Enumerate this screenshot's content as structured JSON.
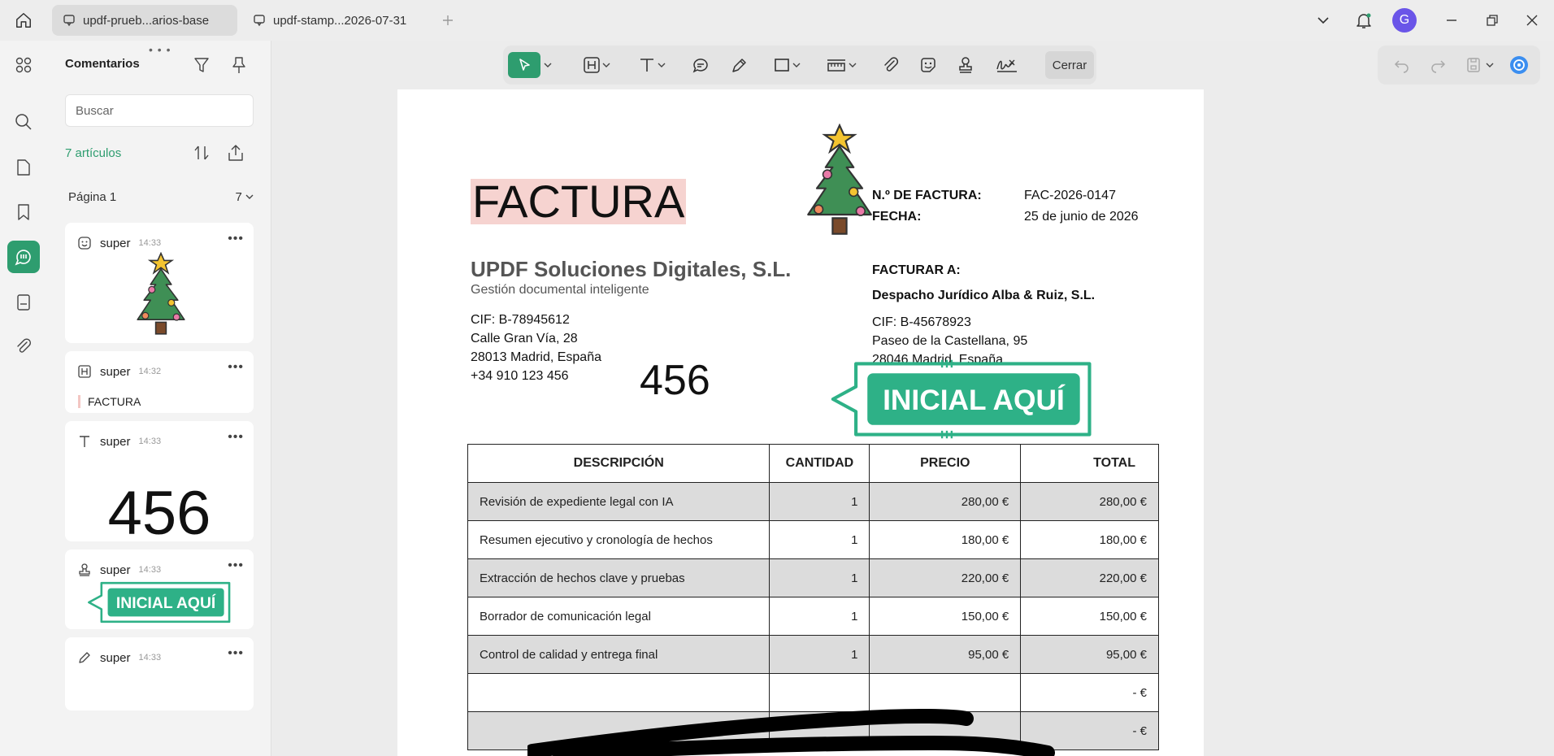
{
  "tabs": [
    {
      "label": "updf-prueb...arios-base",
      "active": true
    },
    {
      "label": "updf-stamp...2026-07-31",
      "active": false
    }
  ],
  "avatar_letter": "G",
  "panel": {
    "title": "Comentarios",
    "search_placeholder": "Buscar",
    "count": "7 artículos",
    "page_label": "Página 1",
    "page_count": "7"
  },
  "comments": [
    {
      "type": "sticker",
      "user": "super",
      "time": "14:33"
    },
    {
      "type": "highlight",
      "user": "super",
      "time": "14:32",
      "text": "FACTURA"
    },
    {
      "type": "text",
      "user": "super",
      "time": "14:33",
      "text": "456"
    },
    {
      "type": "stamp",
      "user": "super",
      "time": "14:33",
      "stamp_text": "INICIAL AQUÍ"
    },
    {
      "type": "pencil",
      "user": "super",
      "time": "14:33"
    }
  ],
  "toolbar": {
    "close_label": "Cerrar"
  },
  "invoice": {
    "title": "FACTURA",
    "company": "UPDF Soluciones Digitales, S.L.",
    "tagline": "Gestión documental inteligente",
    "sender": [
      "CIF: B-78945612",
      "Calle Gran Vía, 28",
      "28013 Madrid, España",
      "+34 910 123 456"
    ],
    "number_label": "N.º DE FACTURA:",
    "number": "FAC-2026-0147",
    "date_label": "FECHA:",
    "date": "25 de junio de 2026",
    "bill_to_label": "FACTURAR A:",
    "client": "Despacho Jurídico Alba & Ruiz, S.L.",
    "client_lines": [
      "CIF: B-45678923",
      "Paseo de la Castellana, 95",
      "28046 Madrid, España"
    ],
    "annotation_text": "456",
    "stamp_text": "INICIAL AQUÍ",
    "table": {
      "headers": [
        "DESCRIPCIÓN",
        "CANTIDAD",
        "PRECIO",
        "TOTAL"
      ],
      "rows": [
        [
          "Revisión de expediente legal con IA",
          "1",
          "280,00 €",
          "280,00 €"
        ],
        [
          "Resumen ejecutivo y cronología de hechos",
          "1",
          "180,00 €",
          "180,00 €"
        ],
        [
          "Extracción de hechos clave y pruebas",
          "1",
          "220,00 €",
          "220,00 €"
        ],
        [
          "Borrador de comunicación legal",
          "1",
          "150,00 €",
          "150,00 €"
        ],
        [
          "Control de calidad y entrega final",
          "1",
          "95,00 €",
          "95,00 €"
        ],
        [
          "",
          "",
          "",
          "- €"
        ],
        [
          "",
          "",
          "",
          "- €"
        ]
      ]
    }
  },
  "colors": {
    "accent": "#2e9d6f",
    "highlight": "#f6d3d0",
    "stamp": "#2eb187",
    "avatar": "#6a55e8"
  }
}
